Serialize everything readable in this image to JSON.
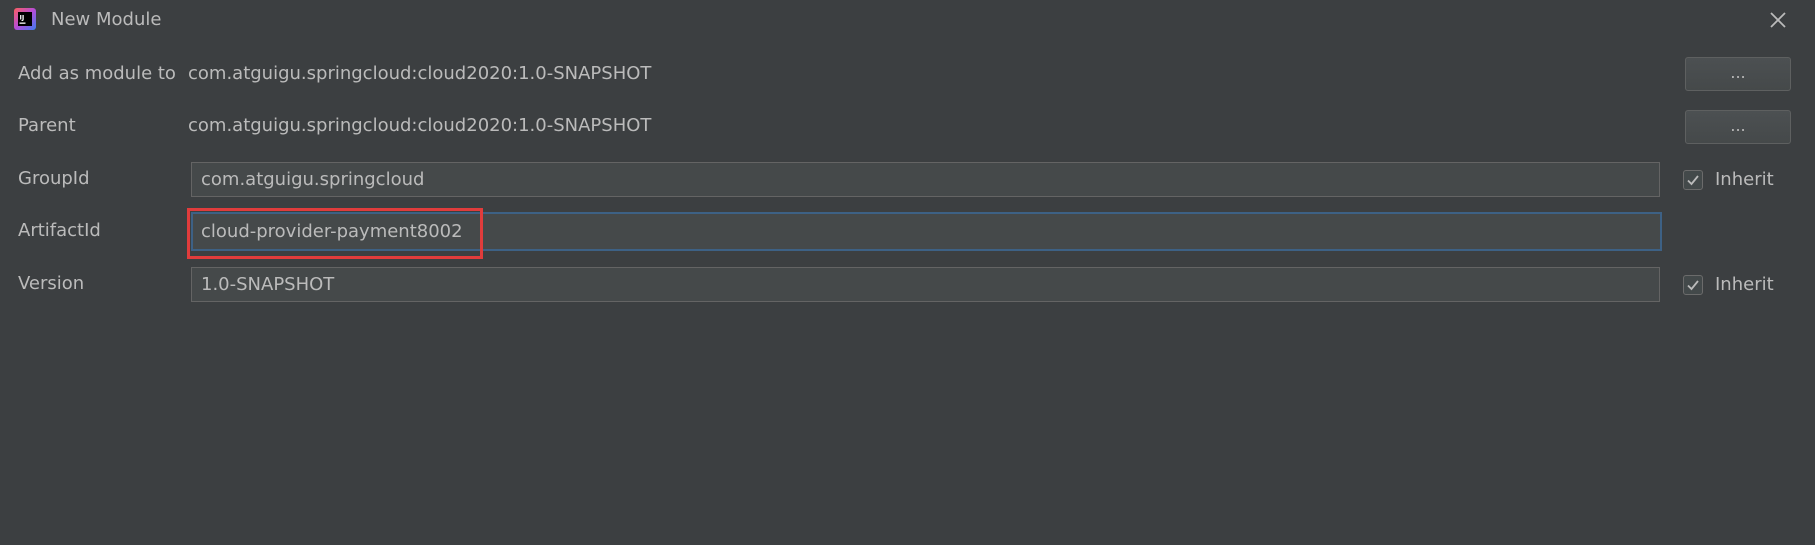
{
  "window": {
    "title": "New Module",
    "icon": "intellij-idea-icon",
    "close_icon": "close-icon"
  },
  "form": {
    "add_as_module_to": {
      "label": "Add as module to",
      "value": "com.atguigu.springcloud:cloud2020:1.0-SNAPSHOT",
      "button_label": "..."
    },
    "parent": {
      "label": "Parent",
      "value": "com.atguigu.springcloud:cloud2020:1.0-SNAPSHOT",
      "button_label": "..."
    },
    "group_id": {
      "label": "GroupId",
      "value": "com.atguigu.springcloud",
      "inherit_label": "Inherit",
      "inherit_checked": true
    },
    "artifact_id": {
      "label": "ArtifactId",
      "value": "cloud-provider-payment8002"
    },
    "version": {
      "label": "Version",
      "value": "1.0-SNAPSHOT",
      "inherit_label": "Inherit",
      "inherit_checked": true
    }
  },
  "colors": {
    "background": "#3c3f41",
    "text": "#bbbbbb",
    "focus_border": "#3d6185",
    "annotation_red": "#e03c3c"
  }
}
